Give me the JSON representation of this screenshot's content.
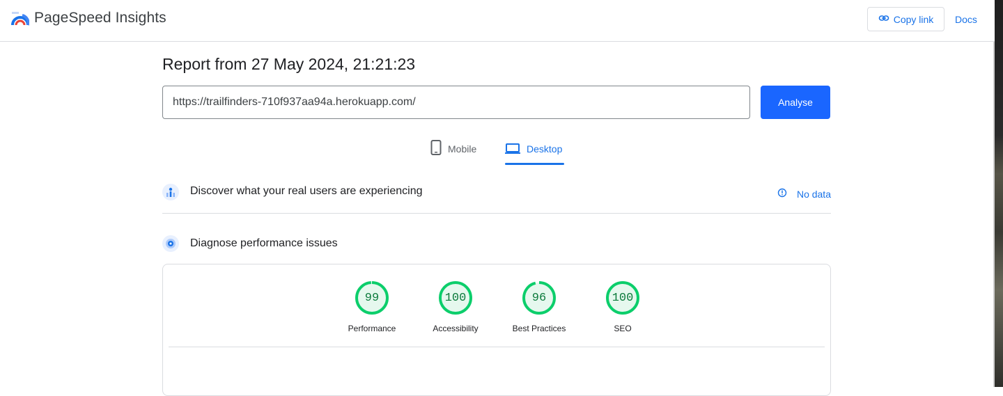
{
  "header": {
    "brand": "PageSpeed Insights",
    "copy_link_label": "Copy link",
    "docs_label": "Docs"
  },
  "report": {
    "title": "Report from 27 May 2024, 21:21:23",
    "url_value": "https://trailfinders-710f937aa94a.herokuapp.com/",
    "analyse_label": "Analyse"
  },
  "tabs": [
    {
      "label": "Mobile",
      "active": false
    },
    {
      "label": "Desktop",
      "active": true
    }
  ],
  "sections": {
    "real_users": {
      "title": "Discover what your real users are experiencing",
      "status": "No data"
    },
    "diagnose": {
      "title": "Diagnose performance issues"
    }
  },
  "scores": [
    {
      "value": "99",
      "label": "Performance",
      "fraction": 0.99
    },
    {
      "value": "100",
      "label": "Accessibility",
      "fraction": 1.0
    },
    {
      "value": "96",
      "label": "Best Practices",
      "fraction": 0.96
    },
    {
      "value": "100",
      "label": "SEO",
      "fraction": 1.0
    }
  ],
  "colors": {
    "accent": "#1a73e8",
    "analyse_button": "#1a66ff",
    "score_pass": "#0cce6b",
    "score_pass_fill": "#e6f8ee",
    "score_text": "#0b7a3b"
  },
  "icons": {
    "logo": "pagespeed-logo",
    "copy": "link-icon",
    "mobile": "phone-icon",
    "desktop": "laptop-icon",
    "users": "users-chart-icon",
    "info": "info-circle-icon",
    "diagnose": "target-icon"
  }
}
